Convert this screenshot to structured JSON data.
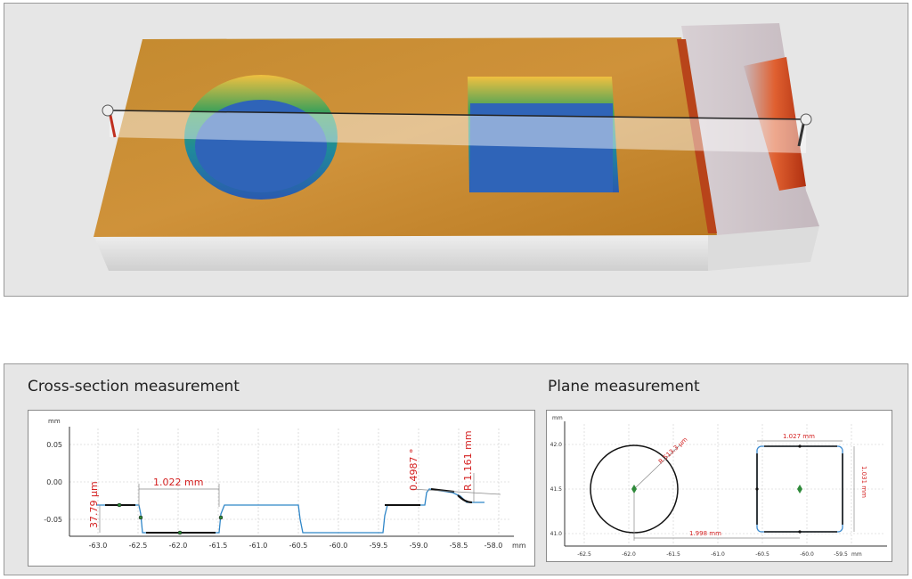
{
  "cross_section": {
    "title": "Cross-section measurement",
    "unit_y": "mm",
    "unit_x": "mm",
    "y_ticks": [
      "0.05",
      "0.00",
      "-0.05"
    ],
    "x_ticks": [
      "-63.0",
      "-62.5",
      "-62.0",
      "-61.5",
      "-61.0",
      "-60.5",
      "-60.0",
      "-59.5",
      "-59.0",
      "-58.5",
      "-58.0"
    ],
    "annotations": {
      "step_height": "37.79 µm",
      "width": "1.022 mm",
      "angle": "0.4987 °",
      "radius": "R 1.161 mm"
    }
  },
  "plane": {
    "title": "Plane measurement",
    "unit_y": "mm",
    "unit_x": "mm",
    "y_ticks": [
      "42.0",
      "41.5",
      "41.0"
    ],
    "x_ticks": [
      "-62.5",
      "-62.0",
      "-61.5",
      "-61.0",
      "-60.5",
      "-60.0",
      "-59.5"
    ],
    "annotations": {
      "circle_radius": "R 513.3 µm",
      "square_width": "1.027 mm",
      "square_height": "1.031 mm",
      "center_distance": "1.998 mm"
    }
  },
  "colors": {
    "annotation": "#d42020",
    "profile": "#2f86c8",
    "surface": "#c98a2b",
    "hole": "#2f64b8"
  }
}
